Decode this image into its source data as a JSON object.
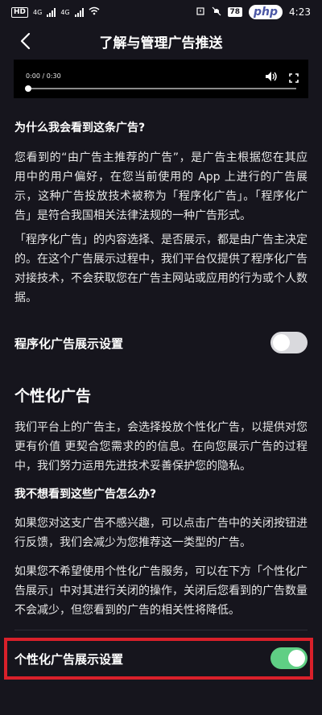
{
  "status_bar": {
    "hd_label": "HD",
    "sig1_label": "4G",
    "sig2_label": "4G",
    "battery": "78",
    "php_badge": "php",
    "time": "4:23"
  },
  "header": {
    "title": "了解与管理广告推送",
    "back_icon": "chevron-left-icon"
  },
  "video": {
    "time": "0:00 / 0:30",
    "progress": 0
  },
  "section1": {
    "heading": "为什么我会看到这条广告?",
    "para1": "您看到的“由广告主推荐的广告”，是广告主根据您在其应用中的用户偏好，在您当前使用的 App 上进行的广告展示，这种广告投放技术被称为「程序化广告」。「程序化广告」是符合我国相关法律法规的一种广告形式。",
    "para2": "「程序化广告」的内容选择、是否展示，都是由广告主决定的。在这个广告展示过程中，我们平台仅提供了程序化广告对接技术，不会获取您在广告主网站或应用的行为或个人数据。"
  },
  "setting1": {
    "label": "程序化广告展示设置",
    "enabled": false
  },
  "section2": {
    "title": "个性化广告",
    "para1": "我们平台上的广告主，会选择投放个性化广告，以提供对您更有价值 更契合您需求的的信息。在向您展示广告的过程中，我们努力运用先进技术妥善保护您的隐私。",
    "heading": "我不想看到这些广告怎么办?",
    "para2": "如果您对这支广告不感兴趣，可以点击广告中的关闭按钮进行反馈，我们会减少为您推荐这一类型的广告。",
    "para3": "如果您不希望使用个性化广告服务，可以在下方「个性化广告展示」中对其进行关闭的操作，关闭后您看到的广告数量不会减少，但您看到的广告的相关性将降低。"
  },
  "setting2": {
    "label": "个性化广告展示设置",
    "enabled": true
  },
  "colors": {
    "background": "#16151d",
    "toggle_on": "#5fcf84",
    "toggle_off": "#d9d9dd",
    "highlight": "#d9202a"
  }
}
